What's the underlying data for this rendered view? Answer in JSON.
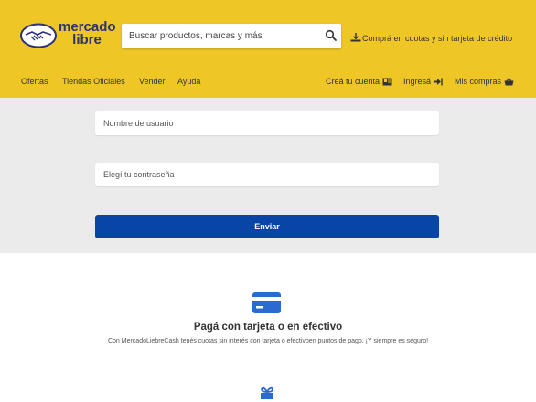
{
  "brand": {
    "line1": "mercado",
    "line2": "libre",
    "logo_icon": "handshake-icon",
    "colors": {
      "header": "#eec726",
      "brand_blue": "#2d3277",
      "primary_button": "#0845a6"
    }
  },
  "search": {
    "placeholder": "Buscar productos, marcas y más",
    "value": "",
    "icon": "search-icon"
  },
  "promo": {
    "label": "Comprá en cuotas y sin tarjeta de crédito",
    "icon": "download-icon"
  },
  "nav": {
    "left": [
      "Ofertas",
      "Tiendas Oficiales",
      "Vender",
      "Ayuda"
    ],
    "create_account": "Creá tu cuenta",
    "login": "Ingresá",
    "purchases": "Mis compras"
  },
  "login_form": {
    "username_placeholder": "Nombre de usuario",
    "password_placeholder": "Elegí tu contraseña",
    "submit_label": "Enviar"
  },
  "feature": {
    "title": "Pagá con tarjeta o en efectivo",
    "description": "Con MercadoLiebreCash tenés cuotas sin interés con tarjeta o efectivoen puntos de pago. ¡Y siempre es seguro!",
    "icon": "credit-card-icon",
    "next_icon": "gift-icon"
  }
}
